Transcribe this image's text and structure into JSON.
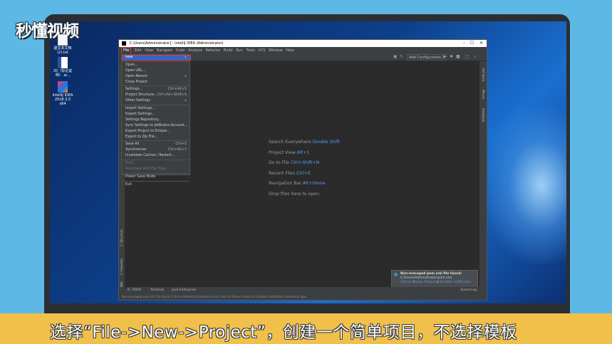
{
  "watermark": {
    "logo_text": "秒懂视频"
  },
  "desktop": {
    "icons": [
      {
        "name": "text-file-icon",
        "label": "建文本文档(2).txt"
      },
      {
        "name": "word-doc-icon",
        "label": "35（标记说明）.w..."
      },
      {
        "name": "intellij-icon",
        "label": "IntelliJ IDEA 2018.3.5 x64"
      }
    ]
  },
  "ide": {
    "title": "C:\\Users\\Administrator] - IntelliJ IDEA (Administrator)",
    "window_controls": [
      "–",
      "☐",
      "✕"
    ],
    "menubar": [
      "File",
      "Edit",
      "View",
      "Navigate",
      "Code",
      "Analyze",
      "Refactor",
      "Build",
      "Run",
      "Tools",
      "VCS",
      "Window",
      "Help"
    ],
    "toolbar": {
      "add_configuration": "Add Configuration..."
    },
    "right_tools": [
      "Ant Build",
      "Maven",
      "Database"
    ],
    "left_tools": [
      "1: Structure",
      "2: Favorites",
      "Web"
    ],
    "file_menu": [
      {
        "label": "New",
        "shortcut": "",
        "highlight": true,
        "submenu": true
      },
      {
        "sep": true
      },
      {
        "label": "Open...",
        "shortcut": ""
      },
      {
        "label": "Open URL...",
        "shortcut": ""
      },
      {
        "label": "Open Recent",
        "shortcut": "",
        "submenu": true
      },
      {
        "label": "Close Project",
        "shortcut": ""
      },
      {
        "sep": true
      },
      {
        "label": "Settings...",
        "shortcut": "Ctrl+Alt+S"
      },
      {
        "label": "Project Structure...",
        "shortcut": "Ctrl+Alt+Shift+S"
      },
      {
        "label": "Other Settings",
        "shortcut": "",
        "submenu": true
      },
      {
        "sep": true
      },
      {
        "label": "Import Settings...",
        "shortcut": ""
      },
      {
        "label": "Export Settings...",
        "shortcut": ""
      },
      {
        "label": "Settings Repository...",
        "shortcut": ""
      },
      {
        "label": "Sync Settings to JetBrains Account...",
        "shortcut": ""
      },
      {
        "label": "Export Project to Eclipse...",
        "shortcut": ""
      },
      {
        "label": "Export to Zip File...",
        "shortcut": ""
      },
      {
        "sep": true
      },
      {
        "label": "Save All",
        "shortcut": "Ctrl+S"
      },
      {
        "label": "Synchronize",
        "shortcut": "Ctrl+Alt+Y"
      },
      {
        "label": "Invalidate Caches / Restart...",
        "shortcut": ""
      },
      {
        "sep": true
      },
      {
        "label": "Print...",
        "shortcut": "",
        "disabled": true
      },
      {
        "label": "Associate with File Type...",
        "shortcut": "",
        "disabled": true
      },
      {
        "sep": true
      },
      {
        "label": "Power Save Mode",
        "shortcut": ""
      },
      {
        "sep": true
      },
      {
        "label": "Exit",
        "shortcut": ""
      }
    ],
    "hints": [
      {
        "text": "Search Everywhere",
        "key": "Double Shift"
      },
      {
        "text": "Project View",
        "key": "Alt+1"
      },
      {
        "text": "Go to File",
        "key": "Ctrl+Shift+N"
      },
      {
        "text": "Recent Files",
        "key": "Ctrl+E"
      },
      {
        "text": "Navigation Bar",
        "key": "Alt+Home"
      },
      {
        "text": "Drop files here to open",
        "key": ""
      }
    ],
    "bottom_tabs": [
      "6: TODO",
      "Terminal",
      "Java Enterprise"
    ],
    "event_log": "Event Log",
    "notification": {
      "title": "Non-managed pom.xml file found:",
      "path": "C:\\Users\\Administrator\\pom.xml",
      "link1": "Add as Maven Project",
      "sep": "or",
      "link2": "Disable notification"
    },
    "status_text": "Non-managed pom.xml file found: C:\\Users\\Administrator\\pom.xml // Add as Maven Project or Disable notification (moments ago)"
  },
  "caption": "选择“File->New->Project”，创建一个简单项目，不选择模板"
}
